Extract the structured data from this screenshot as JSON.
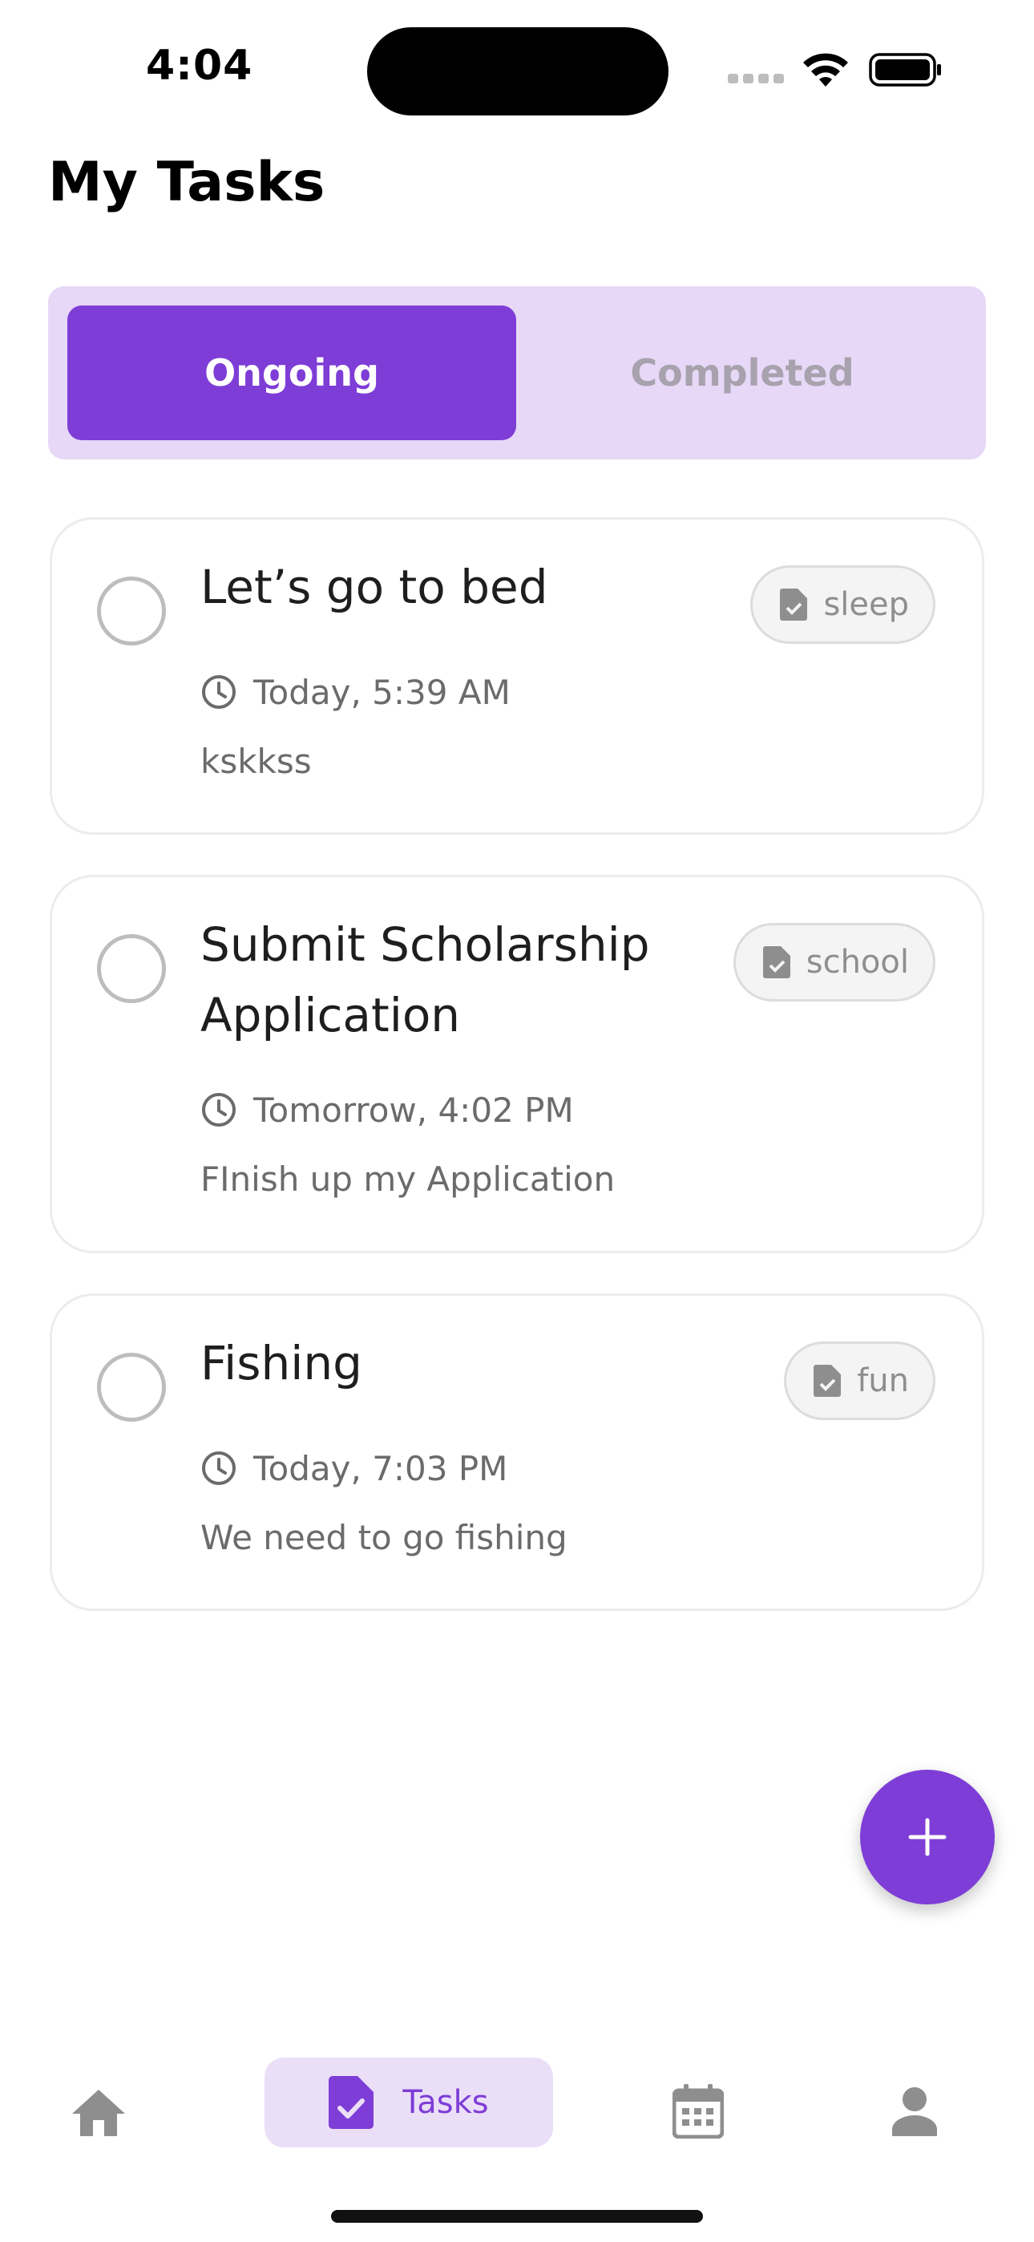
{
  "status_bar": {
    "time": "4:04"
  },
  "page": {
    "title": "My Tasks"
  },
  "tabs": [
    {
      "label": "Ongoing",
      "selected": true
    },
    {
      "label": "Completed",
      "selected": false
    }
  ],
  "tasks": [
    {
      "title": "Let’s go to bed",
      "tag": "sleep",
      "date": "Today, 5:39 AM",
      "description": "kskkss",
      "completed": false
    },
    {
      "title": "Submit Scholarship Application",
      "tag": "school",
      "date": "Tomorrow, 4:02 PM",
      "description": "FInish up my Application",
      "completed": false
    },
    {
      "title": "Fishing",
      "tag": "fun",
      "date": "Today, 7:03 PM",
      "description": "We need to go fishing",
      "completed": false
    }
  ],
  "fab": {
    "icon": "plus-icon"
  },
  "bottom_nav": {
    "items": [
      {
        "icon": "home-icon",
        "label": "",
        "active": false
      },
      {
        "icon": "task-doc-icon",
        "label": "Tasks",
        "active": true
      },
      {
        "icon": "calendar-icon",
        "label": "",
        "active": false
      },
      {
        "icon": "person-icon",
        "label": "",
        "active": false
      }
    ]
  },
  "colors": {
    "accent": "#7E3DD6",
    "accent_light": "#E6D8F6",
    "nav_active_bg": "#EBDFF8",
    "text_primary": "#1E1E1E",
    "text_secondary": "#6B6B6B",
    "icon_gray": "#8E8E8E"
  }
}
